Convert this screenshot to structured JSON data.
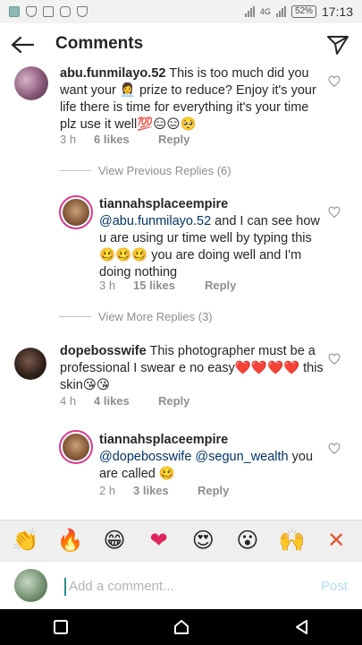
{
  "statusbar": {
    "network": "4G",
    "battery": "52%",
    "time": "17:13"
  },
  "header": {
    "title": "Comments",
    "back_icon": "arrow-left-icon",
    "send_icon": "paper-plane-icon"
  },
  "comments": [
    {
      "username": "abu.funmilayo.52",
      "text": "This is too much did you want your 👩‍💼 prize to reduce? Enjoy it's your life there is time for everything it's your time plz use it well💯😑😑🥺",
      "time": "3 h",
      "likes": "6 likes",
      "reply": "Reply"
    },
    {
      "username": "tiannahsplaceempire",
      "mention": "@abu.funmilayo.52",
      "text": " and I can see how u are using ur time well by typing this 🥴🥴🥴 you are doing well and I'm doing nothing",
      "time": "3 h",
      "likes": "15 likes",
      "reply": "Reply"
    },
    {
      "username": "dopebosswife",
      "text": "This photographer must be a professional I swear e no easy❤️❤️❤️❤️ this skin😘😘",
      "time": "4 h",
      "likes": "4 likes",
      "reply": "Reply"
    },
    {
      "username": "tiannahsplaceempire",
      "mention": "@dopebosswife @segun_wealth",
      "text": " you are called 🥴",
      "time": "2 h",
      "likes": "3 likes",
      "reply": "Reply"
    }
  ],
  "view_previous": "View Previous Replies (6)",
  "view_more": "View More Replies (3)",
  "emoji_bar": [
    "👏",
    "🔥",
    "😁",
    "❤",
    "😍",
    "😮",
    "🙌",
    "✕"
  ],
  "composer": {
    "placeholder": "Add a comment...",
    "post_label": "Post"
  },
  "colors": {
    "accent": "#3897f0",
    "post_disabled": "#b2dffc",
    "story_ring": "#d63a8d",
    "meta_gray": "#8e8e8e"
  }
}
